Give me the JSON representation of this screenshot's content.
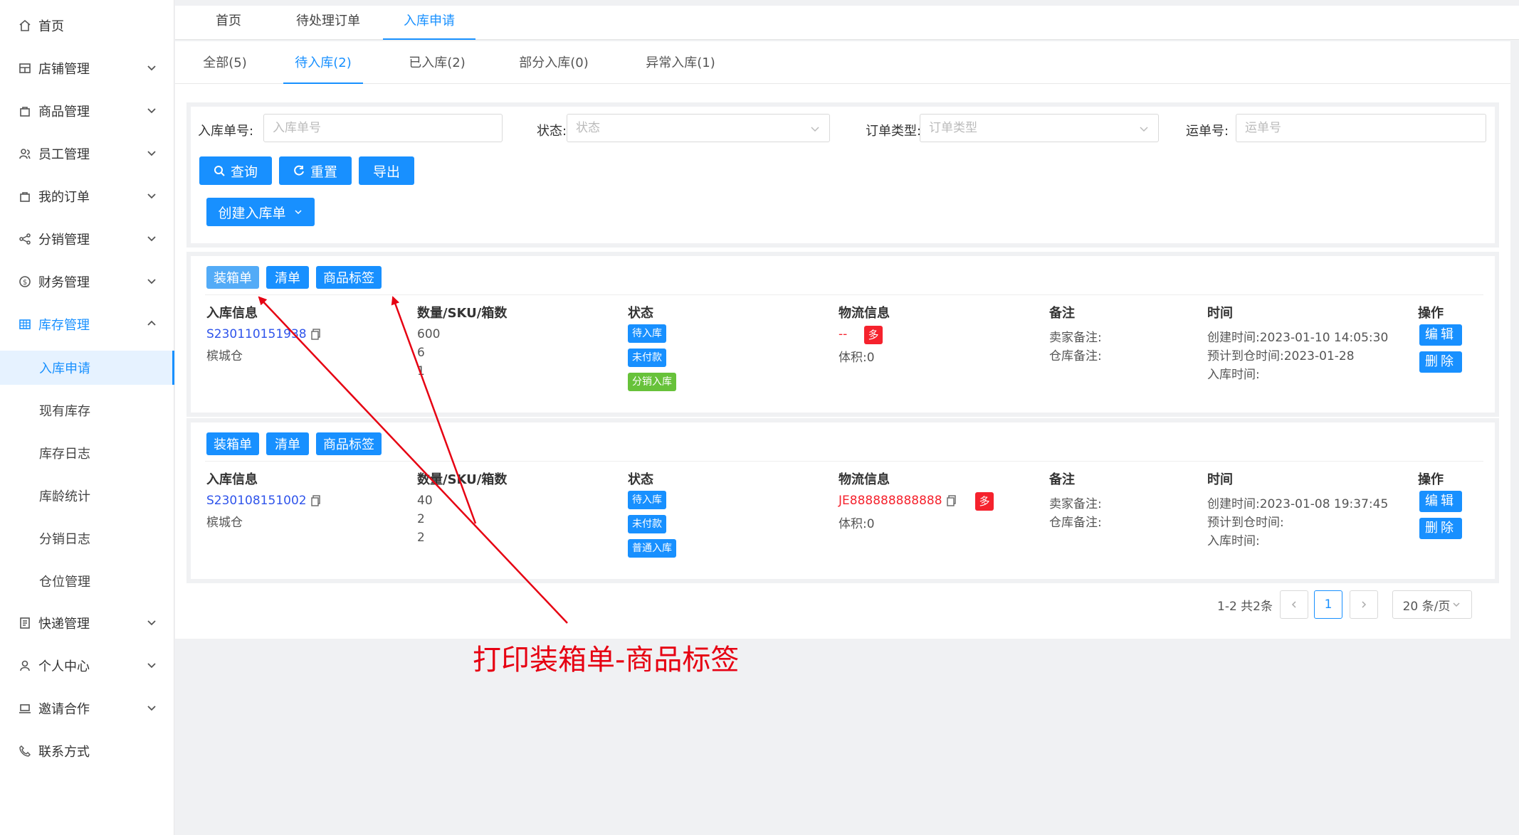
{
  "sidebar": {
    "items": [
      {
        "label": "首页"
      },
      {
        "label": "店铺管理"
      },
      {
        "label": "商品管理"
      },
      {
        "label": "员工管理"
      },
      {
        "label": "我的订单"
      },
      {
        "label": "分销管理"
      },
      {
        "label": "财务管理"
      },
      {
        "label": "库存管理"
      }
    ],
    "sub_items": [
      {
        "label": "入库申请"
      },
      {
        "label": "现有库存"
      },
      {
        "label": "库存日志"
      },
      {
        "label": "库龄统计"
      },
      {
        "label": "分销日志"
      },
      {
        "label": "仓位管理"
      }
    ],
    "bottom_items": [
      {
        "label": "快递管理"
      },
      {
        "label": "个人中心"
      },
      {
        "label": "邀请合作"
      },
      {
        "label": "联系方式"
      }
    ]
  },
  "top_tabs": [
    {
      "label": "首页"
    },
    {
      "label": "待处理订单"
    },
    {
      "label": "入库申请"
    }
  ],
  "sub_tabs": [
    {
      "label": "全部(5)"
    },
    {
      "label": "待入库(2)"
    },
    {
      "label": "已入库(2)"
    },
    {
      "label": "部分入库(0)"
    },
    {
      "label": "异常入库(1)"
    }
  ],
  "filters": {
    "order_no_label": "入库单号:",
    "order_no_placeholder": "入库单号",
    "status_label": "状态:",
    "status_placeholder": "状态",
    "type_label": "订单类型:",
    "type_placeholder": "订单类型",
    "waybill_label": "运单号:",
    "waybill_placeholder": "运单号"
  },
  "buttons": {
    "query": "查询",
    "reset": "重置",
    "export": "导出",
    "create": "创建入库单"
  },
  "card_actions": {
    "packing": "装箱单",
    "list": "清单",
    "label": "商品标签"
  },
  "columns": {
    "info": "入库信息",
    "qty": "数量/SKU/箱数",
    "status": "状态",
    "logistics": "物流信息",
    "remark": "备注",
    "time": "时间",
    "ops": "操作"
  },
  "orders": [
    {
      "order_no": "S230110151938",
      "warehouse": "槟城仓",
      "qty": "600",
      "sku": "6",
      "boxes": "1",
      "tags": [
        "待入库",
        "未付款",
        "分销入库"
      ],
      "tracking": "--",
      "multi": "多",
      "volume": "体积:0",
      "seller_remark": "卖家备注:",
      "warehouse_remark": "仓库备注:",
      "created": "创建时间:2023-01-10 14:05:30",
      "eta": "预计到仓时间:2023-01-28",
      "stocked": "入库时间:",
      "edit": "编辑",
      "delete": "删除"
    },
    {
      "order_no": "S230108151002",
      "warehouse": "槟城仓",
      "qty": "40",
      "sku": "2",
      "boxes": "2",
      "tags": [
        "待入库",
        "未付款",
        "普通入库"
      ],
      "tracking": "JE888888888888",
      "multi": "多",
      "volume": "体积:0",
      "seller_remark": "卖家备注:",
      "warehouse_remark": "仓库备注:",
      "created": "创建时间:2023-01-08 19:37:45",
      "eta": "预计到仓时间:",
      "stocked": "入库时间:",
      "edit": "编辑",
      "delete": "删除"
    }
  ],
  "pagination": {
    "summary": "1-2 共2条",
    "current": "1",
    "page_size": "20 条/页"
  },
  "annotation": {
    "text": "打印装箱单-商品标签",
    "color": "#e60012"
  },
  "colors": {
    "primary": "#1890ff",
    "danger": "#f5222d",
    "success": "#67c23a"
  }
}
